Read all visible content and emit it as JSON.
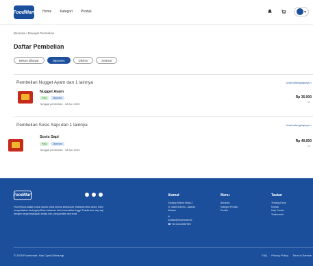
{
  "brand": {
    "logo_text": "FoodMart",
    "accent": "#1b4f9c"
  },
  "header": {
    "nav": [
      "Home",
      "Kategori",
      "Produk"
    ],
    "icons": [
      "notification-icon",
      "cart-icon",
      "avatar-icon"
    ]
  },
  "breadcrumb": "Beranda / Riwayat Pembelian",
  "page_title": "Daftar Pembelian",
  "tabs": [
    {
      "label": "Belum dibayar",
      "active": false
    },
    {
      "label": "Diproses",
      "active": true
    },
    {
      "label": "Dikirim",
      "active": false
    },
    {
      "label": "Selesai",
      "active": false
    }
  ],
  "orders": [
    {
      "title": "Pembelian Nugget Ayam dan 1 lainnya",
      "link": "Lihat selengkapnya >",
      "product": "Nugget Ayam",
      "badges": [
        "Paid",
        "Diproses"
      ],
      "date": "Tanggal pembelian : 18 Apr 2025",
      "price": "Rp 35.000",
      "qty": "x1"
    },
    {
      "title": "Pembelian Sosis Sapi dan 1 lainnya",
      "link": "Lihat selengkapnya >",
      "product": "Sosis Sapi",
      "badges": [
        "Paid",
        "Diproses"
      ],
      "date": "Tanggal pembelian : 18 Apr 2025",
      "price": "Rp 40.000",
      "qty": "x1"
    }
  ],
  "footer": {
    "logo_text": "FoodMart",
    "description": "Frozenfood adalah solusi utama untuk semua kebutuhan makanan beku Anda. Kami menyediakan berbagai pilihan makanan beku berkualitas tinggi. Praktis dan siap saji dengan harga terjangkau setiap hari, yang praktis dan lezat.",
    "alamat": {
      "heading": "Alamat",
      "lines": [
        "Gedung Wisma Mulia 2",
        "Jl. Gatot Subroto, Jakarta",
        "Selatan"
      ],
      "email": "contact@frozenmart.id",
      "phone": "+62 81234567890"
    },
    "menu": {
      "heading": "Menu",
      "items": [
        "Beranda",
        "Kategori Produk",
        "Produk"
      ]
    },
    "tautan": {
      "heading": "Tautan",
      "items": [
        "Tentang Kami",
        "Kontak",
        "Help Center",
        "Testimonial"
      ]
    },
    "copyright": "© 2025 Frozenmart. Hak Cipta Dilindungi",
    "links": [
      "FAQ",
      "Privacy Policy",
      "Term of Service"
    ]
  }
}
